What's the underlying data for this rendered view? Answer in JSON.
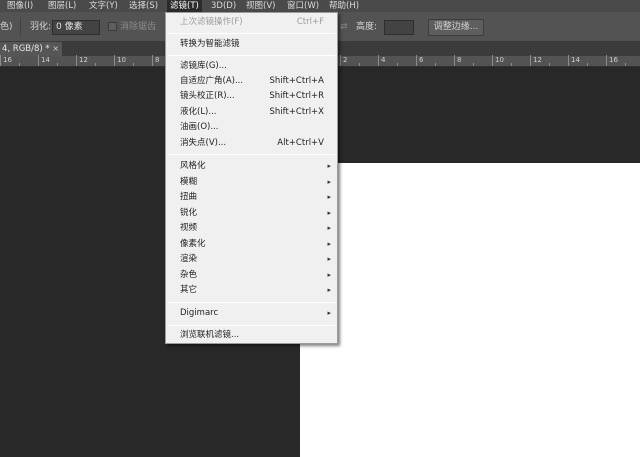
{
  "menubar": {
    "items": [
      "图像(I)",
      "图层(L)",
      "文字(Y)",
      "选择(S)",
      "滤镜(T)",
      "3D(D)",
      "视图(V)",
      "窗口(W)",
      "帮助(H)"
    ]
  },
  "options_bar": {
    "left_fragment": "色)",
    "feather_label": "羽化:",
    "feather_value": "0 像素",
    "antialias_label": "消除锯齿",
    "height_label": "高度:",
    "refine_edge_label": "调整边缘..."
  },
  "document_tab": {
    "title": "4, RGB/8) *",
    "close_glyph": "×"
  },
  "ruler": {
    "labels": [
      "16",
      "14",
      "12",
      "10",
      "8",
      "6",
      "4",
      "2",
      "0",
      "2",
      "4",
      "6",
      "8",
      "10",
      "12",
      "14",
      "16",
      "18",
      "20"
    ]
  },
  "filter_menu": {
    "last_filter": {
      "label": "上次滤镜操作(F)",
      "shortcut": "Ctrl+F"
    },
    "convert_smart": "转换为智能滤镜",
    "group1": [
      {
        "label": "滤镜库(G)...",
        "shortcut": ""
      },
      {
        "label": "自适应广角(A)...",
        "shortcut": "Shift+Ctrl+A"
      },
      {
        "label": "镜头校正(R)...",
        "shortcut": "Shift+Ctrl+R"
      },
      {
        "label": "液化(L)...",
        "shortcut": "Shift+Ctrl+X"
      },
      {
        "label": "油画(O)...",
        "shortcut": ""
      },
      {
        "label": "消失点(V)...",
        "shortcut": "Alt+Ctrl+V"
      }
    ],
    "submenus": [
      "风格化",
      "模糊",
      "扭曲",
      "锐化",
      "视频",
      "像素化",
      "渲染",
      "杂色",
      "其它"
    ],
    "digimarc": "Digimarc",
    "browse_online": "浏览联机滤镜...",
    "arrow_glyph": "▸"
  },
  "colors": {
    "menubar_bg": "#4a4a4a",
    "menu_bg": "#f0f0f0",
    "workspace_bg": "#282828",
    "canvas_bg": "#ffffff"
  }
}
